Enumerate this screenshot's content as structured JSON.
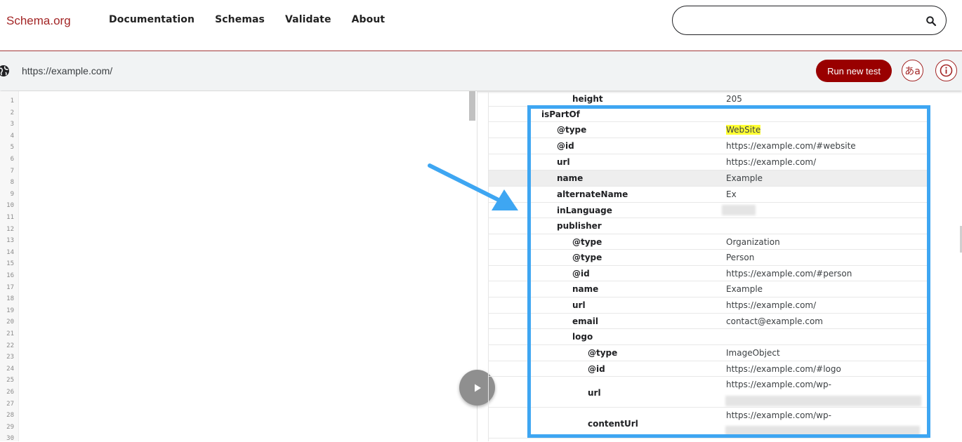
{
  "header": {
    "logo": "Schema.org",
    "nav": [
      "Documentation",
      "Schemas",
      "Validate",
      "About"
    ],
    "search": {
      "value": "",
      "placeholder": ""
    },
    "icons": {
      "search": "search-icon"
    }
  },
  "urlbar": {
    "url": "https://example.com/",
    "run_label": "Run new test",
    "lang_label": "あa",
    "icons": {
      "globe": "globe-icon",
      "info": "info-icon"
    }
  },
  "editor": {
    "line_numbers": [
      "1",
      "2",
      "3",
      "4",
      "5",
      "6",
      "7",
      "8",
      "9",
      "10",
      "11",
      "12",
      "13",
      "14",
      "15",
      "16",
      "17",
      "18",
      "19",
      "20",
      "21",
      "22",
      "23",
      "24",
      "25",
      "26",
      "27",
      "28",
      "29",
      "30"
    ],
    "icons": {
      "run": "play-icon"
    }
  },
  "results": {
    "rows": [
      {
        "prop": "height",
        "value": "205"
      },
      {
        "prop": "isPartOf",
        "value": ""
      },
      {
        "prop": "@type",
        "value": "WebSite"
      },
      {
        "prop": "@id",
        "value": "https://example.com/#website"
      },
      {
        "prop": "url",
        "value": "https://example.com/"
      },
      {
        "prop": "name",
        "value": "Example"
      },
      {
        "prop": "alternateName",
        "value": "Ex"
      },
      {
        "prop": "inLanguage",
        "value": ""
      },
      {
        "prop": "publisher",
        "value": ""
      },
      {
        "prop": "@type",
        "value": "Organization"
      },
      {
        "prop": "@type",
        "value": "Person"
      },
      {
        "prop": "@id",
        "value": "https://example.com/#person"
      },
      {
        "prop": "name",
        "value": "Example"
      },
      {
        "prop": "url",
        "value": "https://example.com/"
      },
      {
        "prop": "email",
        "value": "contact@example.com"
      },
      {
        "prop": "logo",
        "value": ""
      },
      {
        "prop": "@type",
        "value": "ImageObject"
      },
      {
        "prop": "@id",
        "value": "https://example.com/#logo"
      },
      {
        "prop": "url",
        "value": "https://example.com/wp-"
      },
      {
        "prop": "contentUrl",
        "value": "https://example.com/wp-"
      }
    ]
  },
  "colors": {
    "brand": "#a32626",
    "run_button": "#990000",
    "annotation": "#3ea6f2",
    "mark": "#ffff33"
  }
}
